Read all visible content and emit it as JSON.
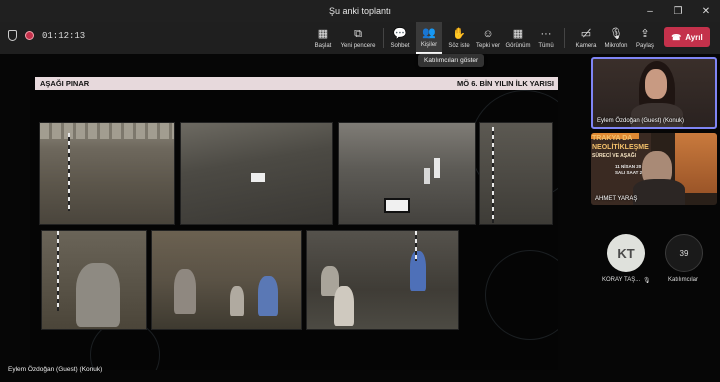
{
  "window": {
    "title": "Şu anki toplantı",
    "controls": [
      "minimize",
      "maximize",
      "close"
    ]
  },
  "toolbar": {
    "timer": "01:12:13",
    "buttons": [
      {
        "id": "baslat",
        "label": "Başlat",
        "icon": "app-icon"
      },
      {
        "id": "yeni-pencere",
        "label": "Yeni pencere",
        "icon": "new-window-icon"
      },
      {
        "id": "sohbet",
        "label": "Sohbet",
        "icon": "chat-icon"
      },
      {
        "id": "kisiler",
        "label": "Kişiler",
        "icon": "people-icon"
      },
      {
        "id": "soz-iste",
        "label": "Söz iste",
        "icon": "raise-hand-icon"
      },
      {
        "id": "tepki-ver",
        "label": "Tepki ver",
        "icon": "reaction-icon"
      },
      {
        "id": "gorunum",
        "label": "Görünüm",
        "icon": "view-icon"
      },
      {
        "id": "tumu",
        "label": "Tümü",
        "icon": "more-icon"
      },
      {
        "id": "kamera",
        "label": "Kamera",
        "icon": "camera-off-icon"
      },
      {
        "id": "mikrofon",
        "label": "Mikrofon",
        "icon": "mic-off-icon"
      },
      {
        "id": "paylas",
        "label": "Paylaş",
        "icon": "share-icon"
      }
    ],
    "leave_label": "Ayrıl",
    "tooltip": "Katılımcıları göster"
  },
  "slide": {
    "header_left": "AŞAĞI PINAR",
    "header_right": "MÖ 6. BİN YILIN İLK YARISI"
  },
  "presenter_label": "Eylem Özdoğan (Guest) (Konuk)",
  "participants": {
    "tile1_name": "Eylem Özdoğan (Guest) (Konuk)",
    "tile2_name": "AHMET YARAŞ",
    "tile2_poster_lines": [
      "TRAKYA DA",
      "NEOLİTİKLEŞME",
      "SÜRECİ VE AŞAĞI",
      "11 NİSAN 20",
      "SALI SAAT 2"
    ],
    "avatar_initials": "KT",
    "avatar_name": "KORAY TAŞ...",
    "overflow_count": "39",
    "overflow_label": "Katılımcılar"
  },
  "colors": {
    "leave": "#c4314b",
    "active_speaker_border": "#7f85f5",
    "slide_header": "#e7d9dc"
  }
}
